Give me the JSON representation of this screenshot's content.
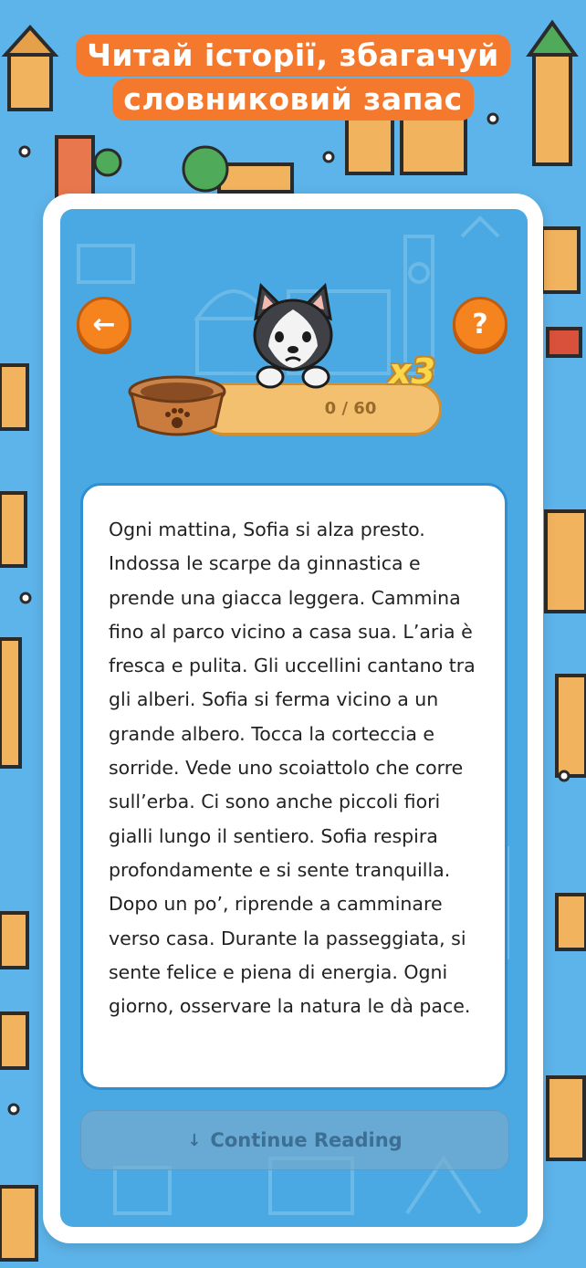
{
  "headline": {
    "line1": "Читай історії, збагачуй",
    "line2": "словниковий запас"
  },
  "colors": {
    "background": "#5db4ea",
    "accent_orange": "#f4792d",
    "button_orange": "#f5841f",
    "progress_bar": "#f3c070"
  },
  "toolbar": {
    "back_icon": "arrow-left-icon",
    "back_glyph": "←",
    "help_icon": "question-mark-icon",
    "help_glyph": "?"
  },
  "progress": {
    "label": "0 / 60",
    "current": 0,
    "total": 60,
    "multiplier": "x3"
  },
  "story": {
    "text": "Ogni mattina, Sofia si alza presto. Indossa le scarpe da ginnastica e prende una giacca leggera. Cammina fino al parco vicino a casa sua. L’aria è fresca e pulita. Gli uccellini cantano tra gli alberi. Sofia si ferma vicino a un grande albero. Tocca la corteccia e sorride. Vede uno scoiattolo che corre sull’erba. Ci sono anche piccoli fiori gialli lungo il sentiero. Sofia respira profondamente e si sente tranquilla. Dopo un po’, riprende a camminare verso casa. Durante la passeggiata, si sente felice e piena di energia. Ogni giorno, osservare la natura le dà pace."
  },
  "continue_button": {
    "icon": "arrow-down-icon",
    "glyph": "↓",
    "label": "Continue Reading"
  }
}
